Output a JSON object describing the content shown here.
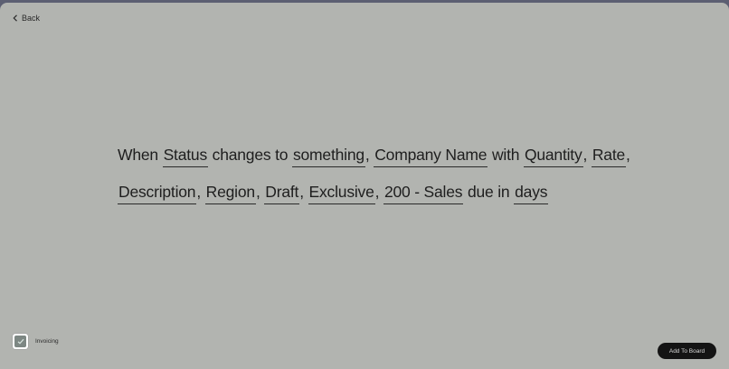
{
  "nav": {
    "back_label": "Back"
  },
  "sentence": {
    "line1": {
      "t1": "When ",
      "status": "Status",
      "t2": " changes to ",
      "something": "something",
      "t3": ", ",
      "company": "Company Name",
      "t4": " with ",
      "quantity": "Quantity",
      "t5": ", ",
      "rate": "Rate",
      "t6": ","
    },
    "line2": {
      "description": "Description",
      "t1": ", ",
      "region": "Region",
      "t2": ", ",
      "draft": "Draft",
      "t3": ", ",
      "exclusive": "Exclusive",
      "t4": ", ",
      "account": "200 - Sales",
      "t5": " due in ",
      "days": "days"
    }
  },
  "app": {
    "name": "Invoicing",
    "icon": "invoicing-app-icon"
  },
  "actions": {
    "add_label": "Add To Board"
  },
  "colors": {
    "background": "#b2b4b0",
    "frame": "#5c5f72",
    "button": "#141414",
    "text": "#1e1e1e"
  }
}
